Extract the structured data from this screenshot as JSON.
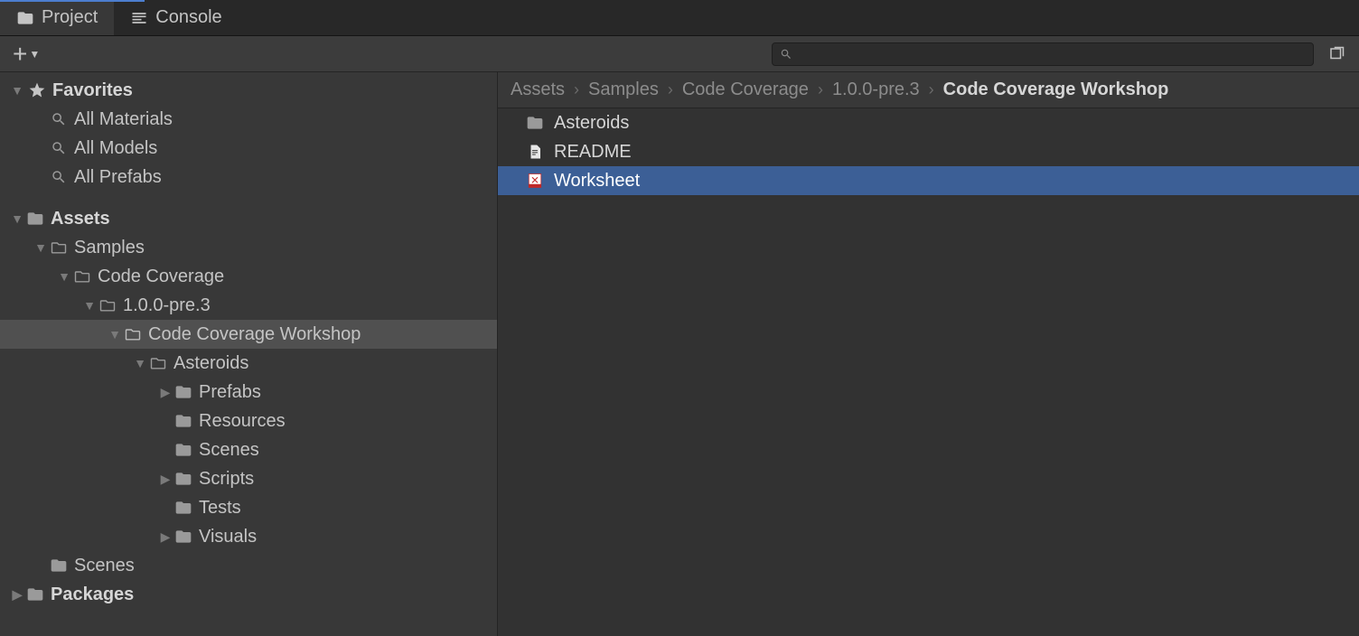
{
  "tabs": {
    "project": "Project",
    "console": "Console"
  },
  "search": {
    "placeholder": ""
  },
  "tree": {
    "favorites": "Favorites",
    "all_materials": "All Materials",
    "all_models": "All Models",
    "all_prefabs": "All Prefabs",
    "assets": "Assets",
    "samples": "Samples",
    "code_coverage": "Code Coverage",
    "version": "1.0.0-pre.3",
    "workshop": "Code Coverage Workshop",
    "asteroids": "Asteroids",
    "prefabs": "Prefabs",
    "resources": "Resources",
    "scenes_sub": "Scenes",
    "scripts": "Scripts",
    "tests": "Tests",
    "visuals": "Visuals",
    "scenes": "Scenes",
    "packages": "Packages"
  },
  "breadcrumb": {
    "c1": "Assets",
    "c2": "Samples",
    "c3": "Code Coverage",
    "c4": "1.0.0-pre.3",
    "c5": "Code Coverage Workshop"
  },
  "files": {
    "asteroids": "Asteroids",
    "readme": "README",
    "worksheet": "Worksheet"
  }
}
